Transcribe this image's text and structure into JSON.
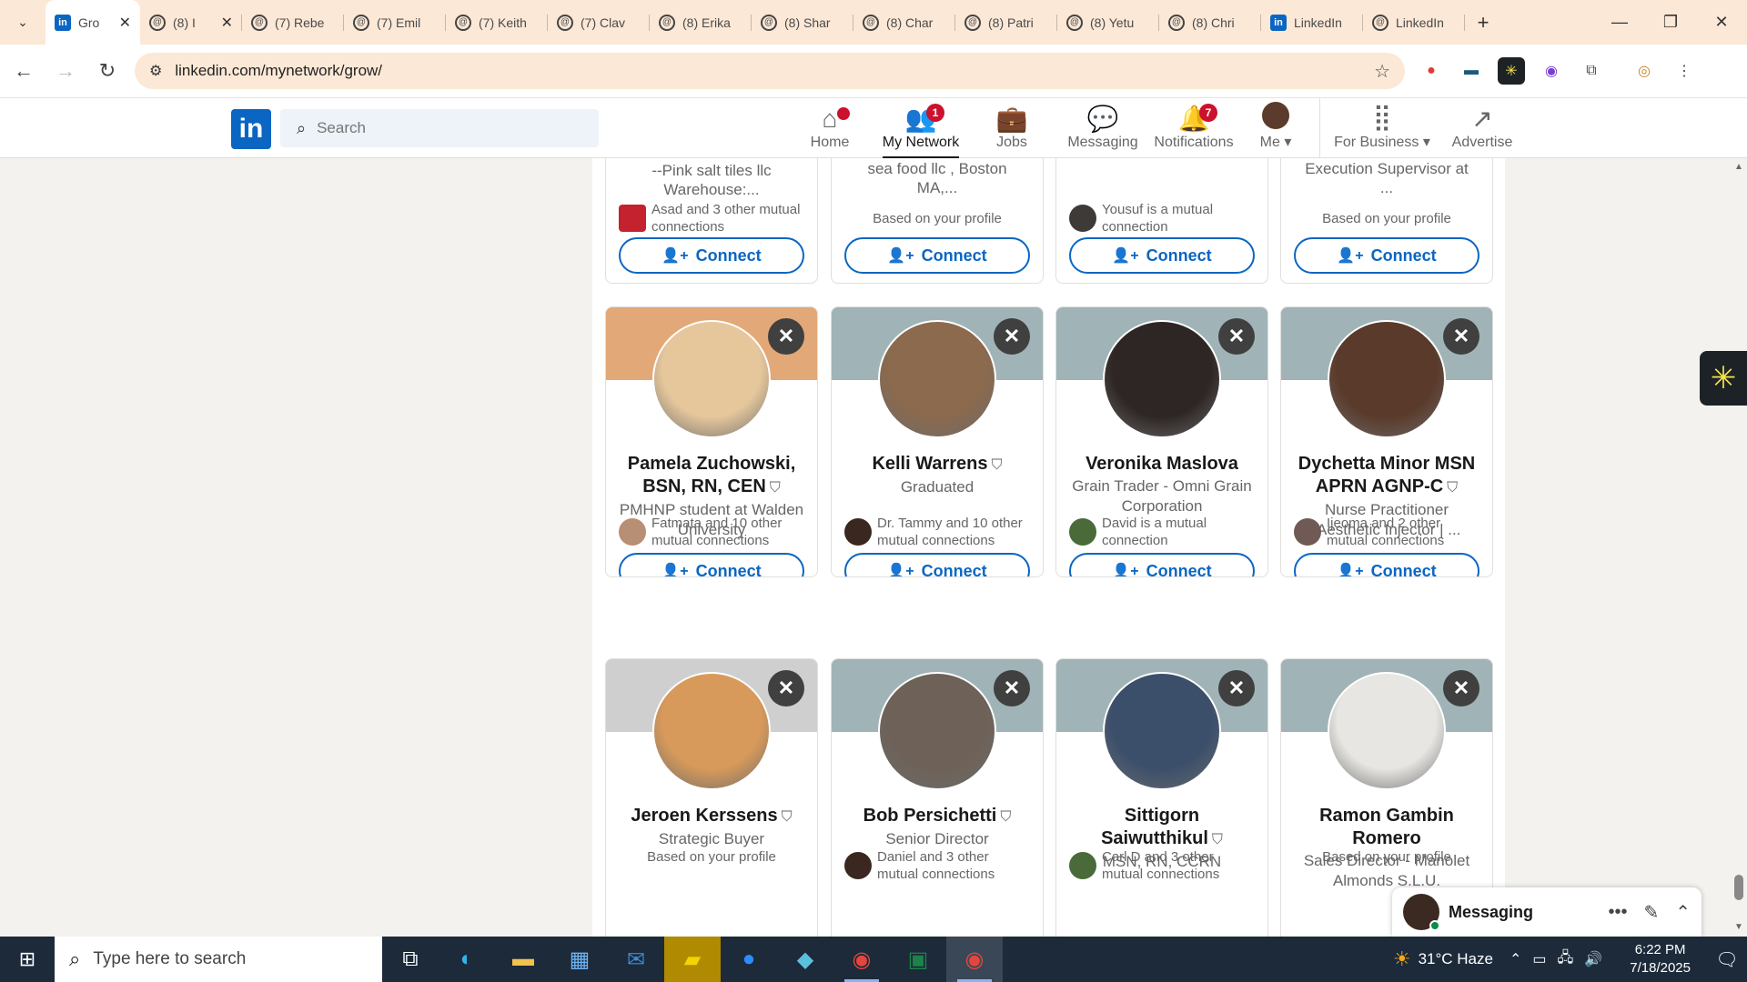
{
  "browser": {
    "tabs": [
      {
        "title": "Gro",
        "icon": "linkedin-icon",
        "active": true
      },
      {
        "title": "(8) I",
        "icon": "threads-icon"
      },
      {
        "title": "(7) Rebe",
        "icon": "threads-icon"
      },
      {
        "title": "(7) Emil",
        "icon": "threads-icon"
      },
      {
        "title": "(7) Keith",
        "icon": "threads-icon"
      },
      {
        "title": "(7) Clav",
        "icon": "threads-icon"
      },
      {
        "title": "(8) Erika",
        "icon": "threads-icon"
      },
      {
        "title": "(8) Shar",
        "icon": "threads-icon"
      },
      {
        "title": "(8) Char",
        "icon": "threads-icon"
      },
      {
        "title": "(8) Patri",
        "icon": "threads-icon"
      },
      {
        "title": "(8) Yetu",
        "icon": "threads-icon"
      },
      {
        "title": "(8) Chri",
        "icon": "threads-icon"
      },
      {
        "title": "LinkedIn",
        "icon": "linkedin-icon"
      },
      {
        "title": "LinkedIn",
        "icon": "threads-icon"
      }
    ],
    "url": "linkedin.com/mynetwork/grow/"
  },
  "linkedin": {
    "logo_text": "in",
    "search_placeholder": "Search",
    "nav": [
      {
        "label": "Home",
        "badge": "",
        "icon": "home-icon"
      },
      {
        "label": "My Network",
        "badge": "1",
        "icon": "network-icon",
        "active": true
      },
      {
        "label": "Jobs",
        "badge": "",
        "icon": "briefcase-icon"
      },
      {
        "label": "Messaging",
        "badge": "",
        "icon": "chat-icon"
      },
      {
        "label": "Notifications",
        "badge": "7",
        "icon": "bell-icon"
      },
      {
        "label": "Me",
        "icon": "avatar"
      },
      {
        "label": "For Business",
        "icon": "grid-icon"
      },
      {
        "label": "Advertise",
        "icon": "advertise-icon"
      }
    ],
    "top_row": [
      {
        "headline_tail": "--Pink salt tiles llc Warehouse:...",
        "mutual": "Asad and 3 other mutual connections",
        "connect": "Connect"
      },
      {
        "headline_tail": "sea food llc , Boston MA,...",
        "mutual": "Based on your profile",
        "connect": "Connect"
      },
      {
        "headline_tail": "",
        "mutual": "Yousuf is a mutual connection",
        "connect": "Connect"
      },
      {
        "headline_tail": "Execution Supervisor at ...",
        "mutual": "Based on your profile",
        "connect": "Connect"
      }
    ],
    "row2": [
      {
        "name": "Pamela Zuchowski, BSN, RN, CEN",
        "headline": "PMHNP student at Walden University",
        "mutual": "Fatmata and 10 other mutual connections",
        "connect": "Connect",
        "banner": "#e3a877",
        "photo": "#e6c79c"
      },
      {
        "name": "Kelli Warrens",
        "headline": "Graduated",
        "mutual": "Dr. Tammy and 10 other mutual connections",
        "connect": "Connect",
        "banner": "#a0b4b7",
        "photo": "#8b6a4e"
      },
      {
        "name": "Veronika Maslova",
        "headline": "Grain Trader - Omni Grain Corporation",
        "mutual": "David is a mutual connection",
        "connect": "Connect",
        "banner": "#a0b4b7",
        "photo": "#2e2624"
      },
      {
        "name": "Dychetta Minor MSN APRN AGNP-C",
        "headline": "Nurse Practitioner |Aesthetic Injector | ...",
        "mutual": "Ijeoma and 2 other mutual connections",
        "connect": "Connect",
        "banner": "#a0b4b7",
        "photo": "#5a3a2a"
      }
    ],
    "row3": [
      {
        "name": "Jeroen Kerssens",
        "headline": "Strategic Buyer",
        "mutual": "Based on your profile",
        "banner": "#cfcfcf",
        "photo": "#d89a5a"
      },
      {
        "name": "Bob Persichetti",
        "headline": "Senior Director",
        "mutual": "Daniel and 3 other mutual connections",
        "banner": "#a0b4b7",
        "photo": "#6e6258"
      },
      {
        "name": "Sittigorn Saiwutthikul",
        "headline": "MSN, RN, CCRN",
        "mutual": "Carl D and 3 other mutual connections",
        "banner": "#a0b4b7",
        "photo": "#3b4f6b"
      },
      {
        "name": "Ramon Gambin Romero",
        "headline": "Sales Director - Manolet Almonds S.L.U.",
        "mutual": "Based on your profile",
        "banner": "#a0b4b7",
        "photo": "#e8e6e2"
      }
    ],
    "messaging_label": "Messaging"
  },
  "taskbar": {
    "search_placeholder": "Type here to search",
    "weather": "31°C Haze",
    "time": "6:22 PM",
    "date": "7/18/2025"
  },
  "colors": {
    "linkedin_blue": "#0a66c2",
    "badge_red": "#cb112d",
    "tab_strip": "#fce8d6"
  }
}
